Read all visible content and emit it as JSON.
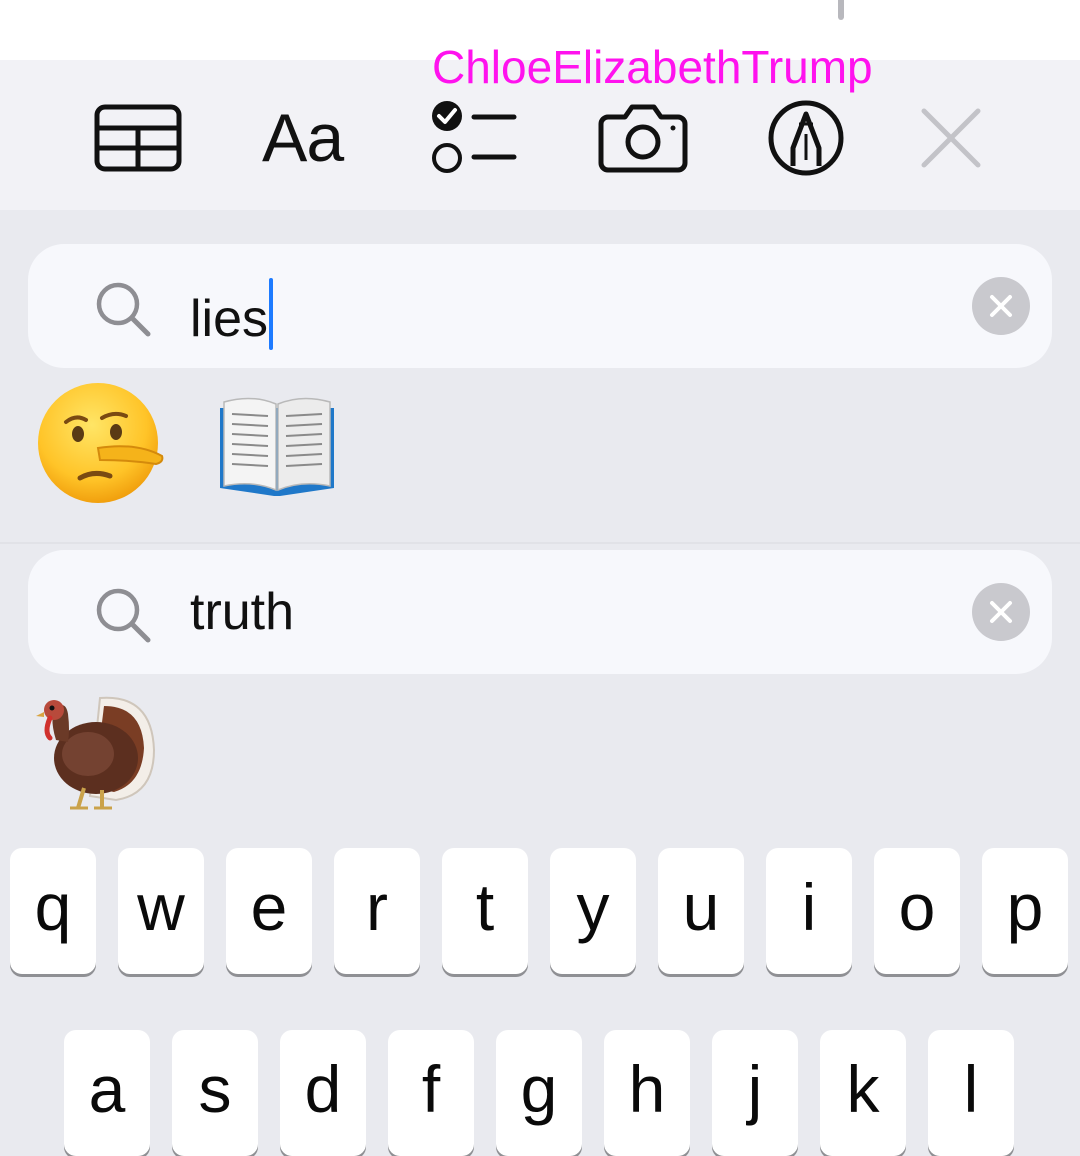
{
  "watermark": "ChloeElizabethTrump",
  "toolbar": {
    "items": [
      {
        "icon": "table-icon"
      },
      {
        "icon": "text-format-icon",
        "label": "Aa"
      },
      {
        "icon": "checklist-icon"
      },
      {
        "icon": "camera-icon"
      },
      {
        "icon": "markup-pen-icon"
      },
      {
        "icon": "close-icon"
      }
    ]
  },
  "emoji_search": [
    {
      "query": "lies",
      "results": [
        "lying-face-emoji",
        "open-book-emoji"
      ],
      "focused": true
    },
    {
      "query": "truth",
      "results": [
        "turkey-emoji"
      ],
      "focused": false
    }
  ],
  "keyboard": {
    "row1": [
      "q",
      "w",
      "e",
      "r",
      "t",
      "y",
      "u",
      "i",
      "o",
      "p"
    ],
    "row2": [
      "a",
      "s",
      "d",
      "f",
      "g",
      "h",
      "j",
      "k",
      "l"
    ]
  },
  "colors": {
    "watermark": "#ff12ee",
    "caret": "#1e7bff",
    "keyboard_bg": "#e9eaef",
    "toolbar_bg": "#f2f2f6"
  }
}
